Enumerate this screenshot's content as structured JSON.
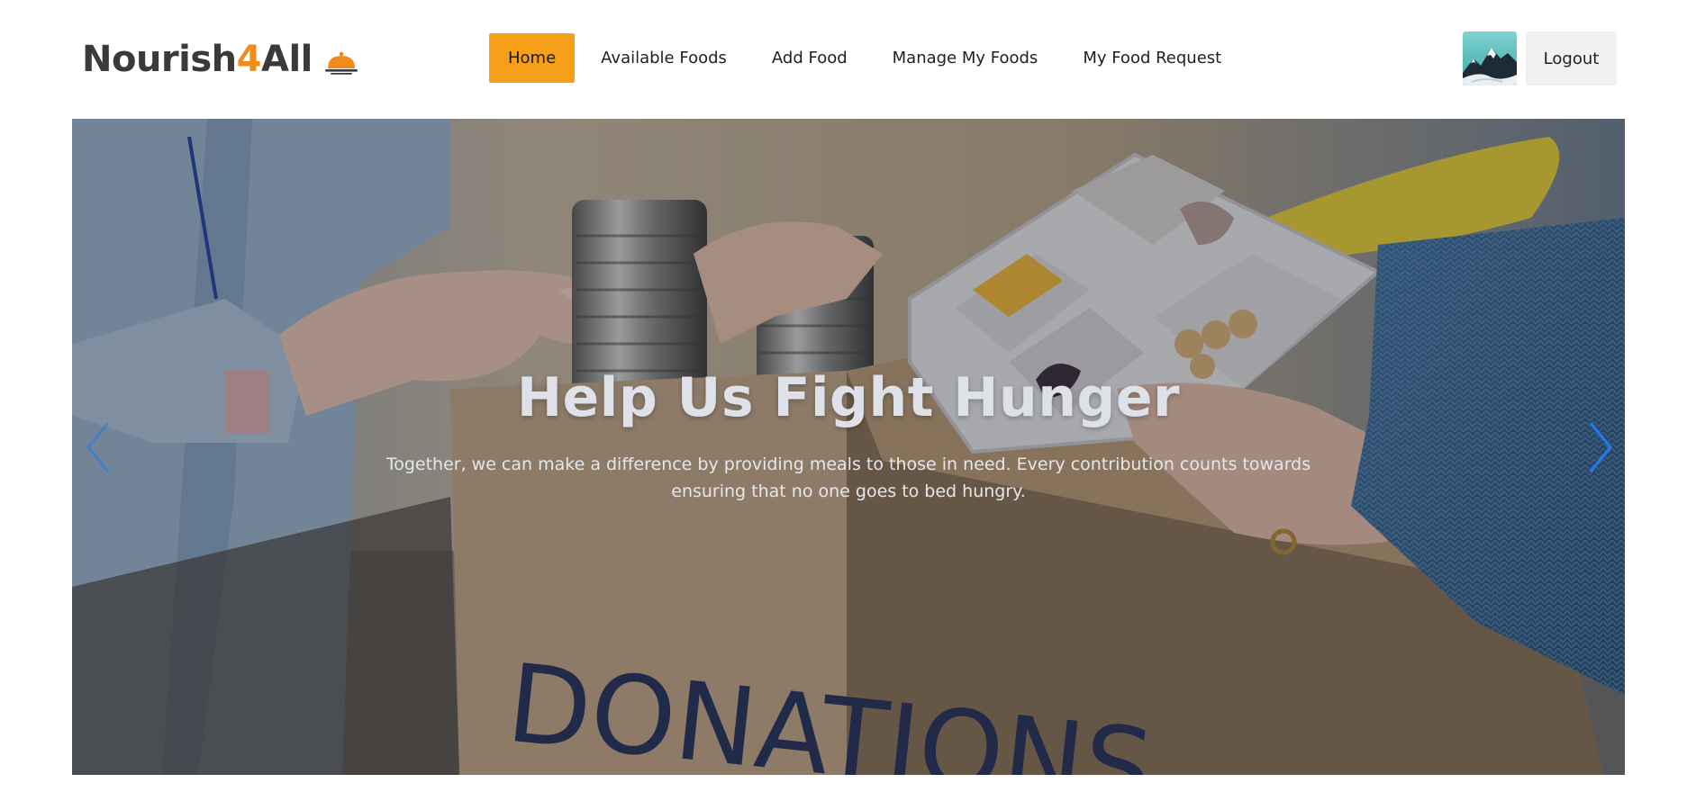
{
  "brand": {
    "name_part1": "Nourish",
    "name_accent": "4",
    "name_part2": "All",
    "icon": "food-cloche-icon",
    "accent_color": "#f08c1b"
  },
  "nav": {
    "items": [
      {
        "label": "Home",
        "active": true
      },
      {
        "label": "Available Foods",
        "active": false
      },
      {
        "label": "Add Food",
        "active": false
      },
      {
        "label": "Manage My Foods",
        "active": false
      },
      {
        "label": "My Food Request",
        "active": false
      }
    ],
    "active_color": "#f6a01a"
  },
  "user": {
    "avatar_icon": "mountain-avatar",
    "logout_label": "Logout"
  },
  "hero": {
    "title": "Help Us Fight Hunger",
    "subtitle": "Together, we can make a difference by providing meals to those in need. Every contribution counts towards ensuring that no one goes to bed hungry.",
    "box_text": "DONATIONS",
    "prev_icon": "chevron-left-icon",
    "next_icon": "chevron-right-icon",
    "arrow_color": "#1e7bf0"
  }
}
